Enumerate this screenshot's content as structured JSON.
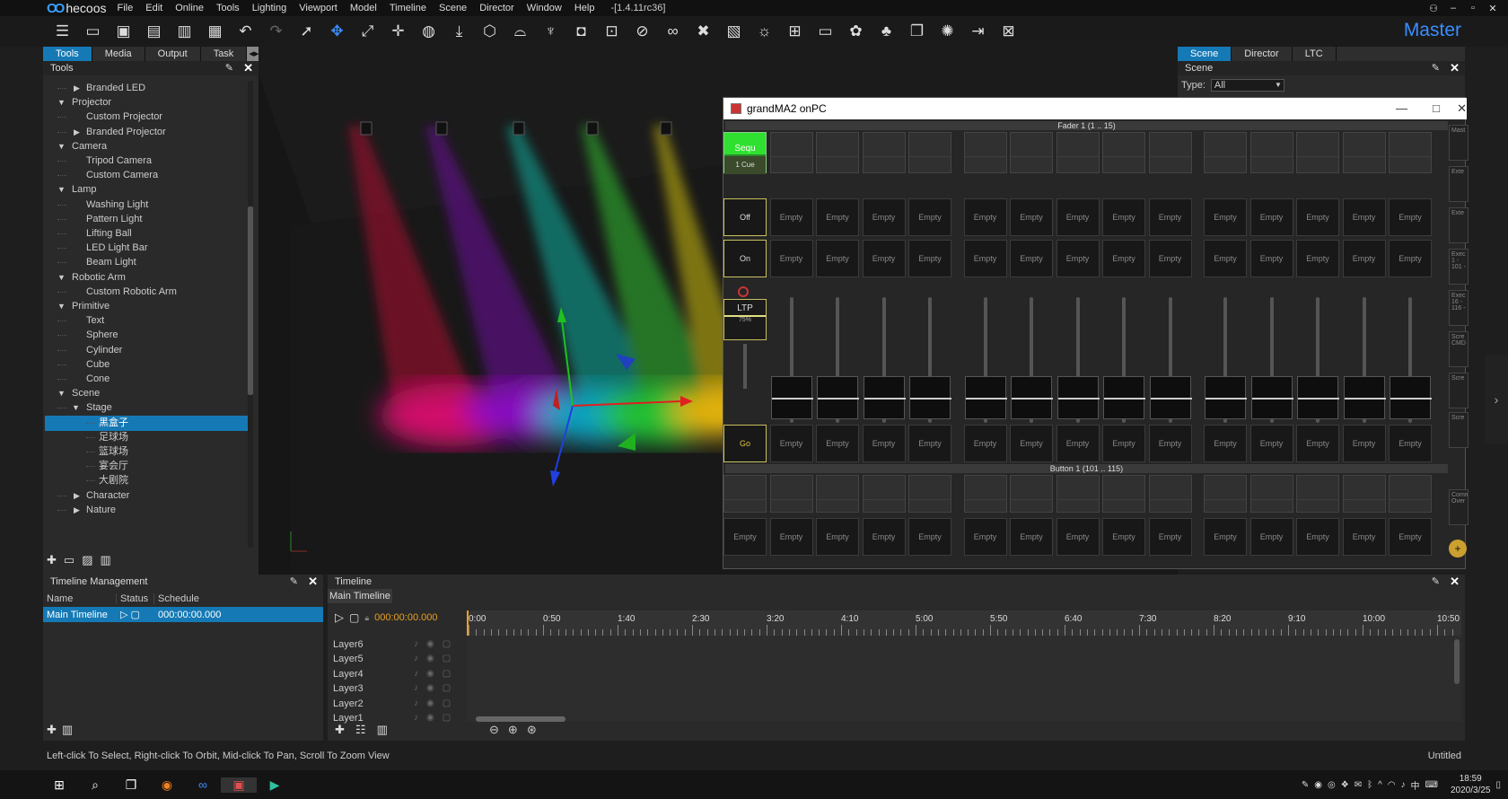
{
  "app": {
    "name": "hecoos",
    "version": "-[1.4.11rc36]",
    "workspace": "Master"
  },
  "menu": [
    "File",
    "Edit",
    "Online",
    "Tools",
    "Lighting",
    "Viewport",
    "Model",
    "Timeline",
    "Scene",
    "Director",
    "Window",
    "Help"
  ],
  "left_tabs": [
    "Tools",
    "Media",
    "Output",
    "Task"
  ],
  "tools_title": "Tools",
  "tree": [
    {
      "label": "Branded LED",
      "level": 1,
      "exp": "closed"
    },
    {
      "label": "Projector",
      "level": 0,
      "exp": "open"
    },
    {
      "label": "Custom Projector",
      "level": 1,
      "exp": "none"
    },
    {
      "label": "Branded Projector",
      "level": 1,
      "exp": "closed"
    },
    {
      "label": "Camera",
      "level": 0,
      "exp": "open"
    },
    {
      "label": "Tripod Camera",
      "level": 1,
      "exp": "none"
    },
    {
      "label": "Custom Camera",
      "level": 1,
      "exp": "none"
    },
    {
      "label": "Lamp",
      "level": 0,
      "exp": "open"
    },
    {
      "label": "Washing Light",
      "level": 1,
      "exp": "none"
    },
    {
      "label": "Pattern Light",
      "level": 1,
      "exp": "none"
    },
    {
      "label": "Lifting Ball",
      "level": 1,
      "exp": "none"
    },
    {
      "label": "LED Light Bar",
      "level": 1,
      "exp": "none"
    },
    {
      "label": "Beam Light",
      "level": 1,
      "exp": "none"
    },
    {
      "label": "Robotic Arm",
      "level": 0,
      "exp": "open"
    },
    {
      "label": "Custom Robotic Arm",
      "level": 1,
      "exp": "none"
    },
    {
      "label": "Primitive",
      "level": 0,
      "exp": "open"
    },
    {
      "label": "Text",
      "level": 1,
      "exp": "none"
    },
    {
      "label": "Sphere",
      "level": 1,
      "exp": "none"
    },
    {
      "label": "Cylinder",
      "level": 1,
      "exp": "none"
    },
    {
      "label": "Cube",
      "level": 1,
      "exp": "none"
    },
    {
      "label": "Cone",
      "level": 1,
      "exp": "none"
    },
    {
      "label": "Scene",
      "level": 0,
      "exp": "open"
    },
    {
      "label": "Stage",
      "level": 1,
      "exp": "open"
    },
    {
      "label": "黑盒子",
      "level": 2,
      "exp": "none",
      "selected": true
    },
    {
      "label": "足球场",
      "level": 2,
      "exp": "none"
    },
    {
      "label": "篮球场",
      "level": 2,
      "exp": "none"
    },
    {
      "label": "宴会厅",
      "level": 2,
      "exp": "none"
    },
    {
      "label": "大剧院",
      "level": 2,
      "exp": "none"
    },
    {
      "label": "Character",
      "level": 1,
      "exp": "closed"
    },
    {
      "label": "Nature",
      "level": 1,
      "exp": "closed"
    }
  ],
  "right_tabs": [
    "Scene",
    "Director",
    "LTC"
  ],
  "scene_panel": {
    "title": "Scene",
    "type_label": "Type:",
    "type_value": "All"
  },
  "ma2": {
    "title": "grandMA2 onPC",
    "fader_header": "Fader  1 (1 .. 15)",
    "button_header": "Button  1 (101 .. 115)",
    "exec1_label": "Sequ",
    "exec1_sub": "1 Cue",
    "off": "Off",
    "on": "On",
    "ltp": "LTP",
    "ltp_pct": "75%",
    "go": "Go",
    "empty": "Empty",
    "side": [
      "Mast",
      "Exte",
      "Exte",
      "Exec 1 - 101 -",
      "Exec 16 - 116 -",
      "Scre CMD",
      "Scre",
      "Scre",
      "Comm Over"
    ]
  },
  "timeline_mgmt": {
    "title": "Timeline Management",
    "cols": [
      "Name",
      "Status",
      "Schedule"
    ],
    "row": {
      "name": "Main Timeline",
      "time": "000:00:00.000"
    }
  },
  "timeline": {
    "title": "Timeline",
    "tab": "Main Timeline",
    "time": "000:00:00.000",
    "ticks": [
      "0:00",
      "0:50",
      "1:40",
      "2:30",
      "3:20",
      "4:10",
      "5:00",
      "5:50",
      "6:40",
      "7:30",
      "8:20",
      "9:10",
      "10:00",
      "10:50"
    ],
    "layers": [
      "Layer6",
      "Layer5",
      "Layer4",
      "Layer3",
      "Layer2",
      "Layer1"
    ]
  },
  "status": {
    "hint": "Left-click To Select, Right-click To Orbit, Mid-click To Pan, Scroll To Zoom View",
    "file": "Untitled"
  },
  "taskbar": {
    "time": "18:59",
    "date": "2020/3/25",
    "ime": "中"
  }
}
